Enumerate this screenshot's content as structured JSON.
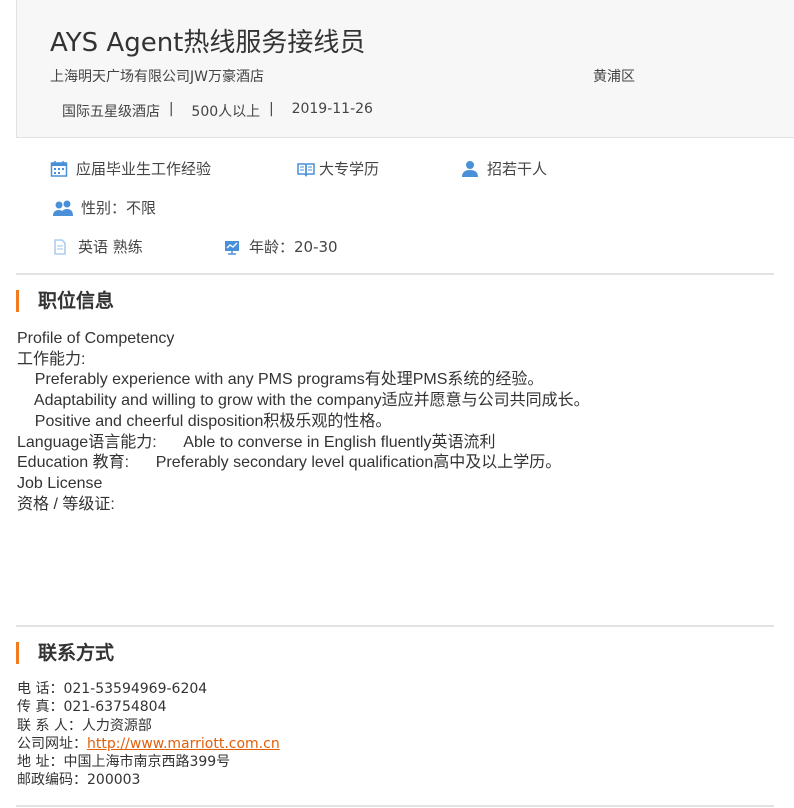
{
  "header": {
    "job_title": "AYS Agent热线服务接线员",
    "company": "上海明天广场有限公司JW万豪酒店",
    "district": "黄浦区",
    "meta": [
      "国际五星级酒店",
      "  |    ",
      "500人以上",
      "  |    ",
      "2019-11-26"
    ]
  },
  "requirements": {
    "experience": "应届毕业生工作经验",
    "education": "大专学历",
    "headcount": "招若干人",
    "gender": "性别：不限",
    "language": "英语 熟练",
    "age": "年龄：20-30"
  },
  "icons": {
    "experience": "calendar-icon",
    "education": "book-icon",
    "headcount": "person-icon",
    "gender": "users-icon",
    "language": "document-icon",
    "age": "chart-icon"
  },
  "sections": {
    "job_info": "职位信息",
    "contact": "联系方式"
  },
  "description": [
    "Profile of Competency",
    "工作能力:",
    "    Preferably experience with any PMS programs有处理PMS系统的经验。",
    "    Adaptability and willing to grow with the company适应并愿意与公司共同成长。",
    "    Positive and cheerful disposition积极乐观的性格。",
    "Language语言能力:      Able to converse in English fluently英语流利",
    "Education 教育:      Preferably secondary level qualification高中及以上学历。",
    "Job License",
    "资格 / 等级证:"
  ],
  "contact": {
    "phone": "电 话：021-53594969-6204",
    "fax": "传 真：021-63754804",
    "person": "联 系 人：人力资源部",
    "website_label": "公司网址：",
    "website": "http://www.marriott.com.cn",
    "address": "地 址：中国上海市南京西路399号",
    "postcode": "邮政编码：200003"
  },
  "colors": {
    "accent": "#f07a20",
    "icon_blue": "#4a90d9",
    "link": "#e0600c"
  }
}
